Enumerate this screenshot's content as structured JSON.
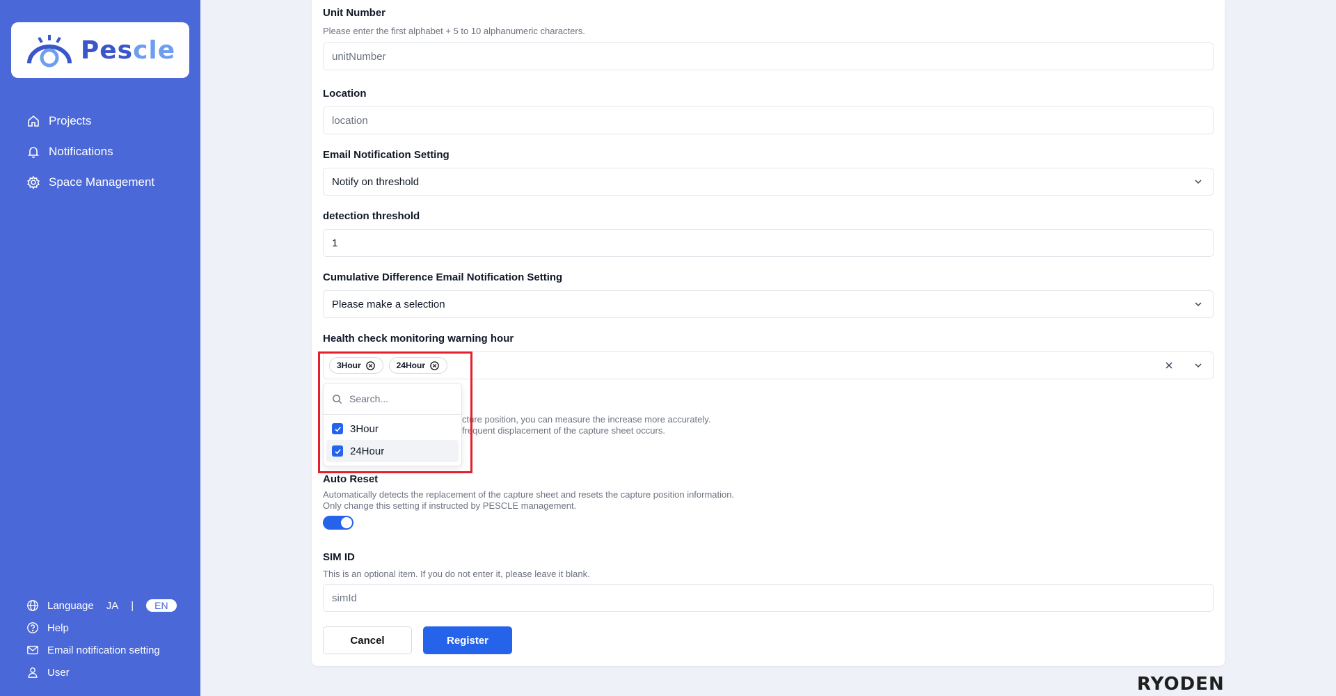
{
  "brand": {
    "logo_text_main": "Pes",
    "logo_text_accent": "cle",
    "footer_logo": "RYODEN"
  },
  "sidebar": {
    "items": [
      {
        "label": "Projects",
        "icon": "home-icon"
      },
      {
        "label": "Notifications",
        "icon": "bell-icon"
      },
      {
        "label": "Space Management",
        "icon": "gear-icon"
      }
    ],
    "bottom": {
      "language_label": "Language",
      "lang_ja": "JA",
      "lang_sep": "|",
      "lang_en": "EN",
      "help": "Help",
      "email_setting": "Email notification setting",
      "user": "User"
    }
  },
  "form": {
    "unit_number": {
      "label": "Unit Number",
      "desc": "Please enter the first alphabet + 5 to 10 alphanumeric characters.",
      "placeholder": "unitNumber"
    },
    "location": {
      "label": "Location",
      "placeholder": "location"
    },
    "email_setting": {
      "label": "Email Notification Setting",
      "value": "Notify on threshold"
    },
    "threshold": {
      "label": "detection threshold",
      "value": "1"
    },
    "cumulative": {
      "label": "Cumulative Difference Email Notification Setting",
      "value": "Please make a selection"
    },
    "health_check": {
      "label": "Health check monitoring warning hour",
      "tags": [
        "3Hour",
        "24Hour"
      ],
      "search_placeholder": "Search...",
      "options": [
        {
          "label": "3Hour",
          "checked": true
        },
        {
          "label": "24Hour",
          "checked": true
        }
      ]
    },
    "hidden_desc": {
      "line1_fragment": "cture position, you can measure the increase more accurately.",
      "line2_fragment": "frequent displacement of the capture sheet occurs."
    },
    "auto_reset": {
      "label": "Auto Reset",
      "desc1": "Automatically detects the replacement of the capture sheet and resets the capture position information.",
      "desc2": "Only change this setting if instructed by PESCLE management.",
      "enabled": true
    },
    "sim_id": {
      "label": "SIM ID",
      "desc": "This is an optional item. If you do not enter it, please leave it blank.",
      "placeholder": "simId"
    },
    "cancel": "Cancel",
    "register": "Register"
  },
  "colors": {
    "sidebar": "#4b68d8",
    "primary": "#2563eb",
    "highlight": "#e3202c"
  }
}
